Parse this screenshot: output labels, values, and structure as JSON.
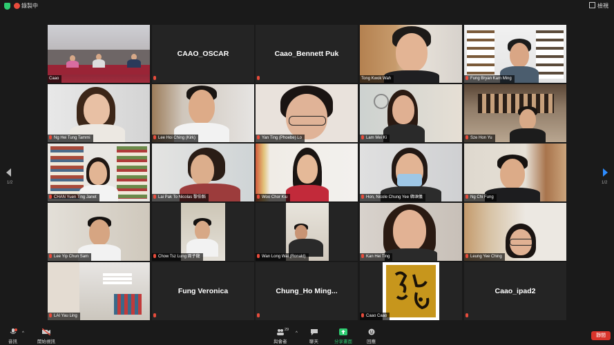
{
  "topbar": {
    "recording_label": "錄製中",
    "view_label": "檢視"
  },
  "pagination": {
    "left": "1/2",
    "right": "1/2"
  },
  "tiles": [
    {
      "name": "Caao"
    },
    {
      "name": "CAAO_OSCAR"
    },
    {
      "name": "Caao_Bennett Puk"
    },
    {
      "name": "Tong Kwok Wah"
    },
    {
      "name": "Fung Bryan Kam Ming"
    },
    {
      "name": "Ng Hei Tung Tammi"
    },
    {
      "name": "Lee Hoi Ching (Kirk)"
    },
    {
      "name": "Yan Ting (Phoebe) Lo"
    },
    {
      "name": "Lam Mei Ki"
    },
    {
      "name": "Sze Hon Yu"
    },
    {
      "name": "CHAN Yuen Ting Janet"
    },
    {
      "name": "Lai Pak To Nicolas 黎伯韜"
    },
    {
      "name": "Woo Chor Kiu"
    },
    {
      "name": "Hon, Nicole Chung Yee 韓頌儀"
    },
    {
      "name": "Ng Chi Fung"
    },
    {
      "name": "Lee Yip Chun Sam"
    },
    {
      "name": "Chow Tsz Lung 周子龍"
    },
    {
      "name": "Wan Long Wai (Ronald)"
    },
    {
      "name": "Kan Hei Ting"
    },
    {
      "name": "Leung Yee Ching"
    },
    {
      "name": "LAI Yau Ling"
    },
    {
      "name": "Fung Veronica"
    },
    {
      "name": "Chung_Ho Ming..."
    },
    {
      "name": "Caao Caao"
    },
    {
      "name": "Caao_ipad2"
    }
  ],
  "toolbar": {
    "audio": "音訊",
    "video": "開始視訊",
    "participants": "與會者",
    "participants_count": "29",
    "chat": "聊天",
    "share": "分享畫面",
    "reactions": "回應",
    "end": "靜間"
  },
  "colors": {
    "active_speaker": "#b8d64e",
    "share_green": "#2ecc71",
    "end_red": "#d9342b"
  }
}
